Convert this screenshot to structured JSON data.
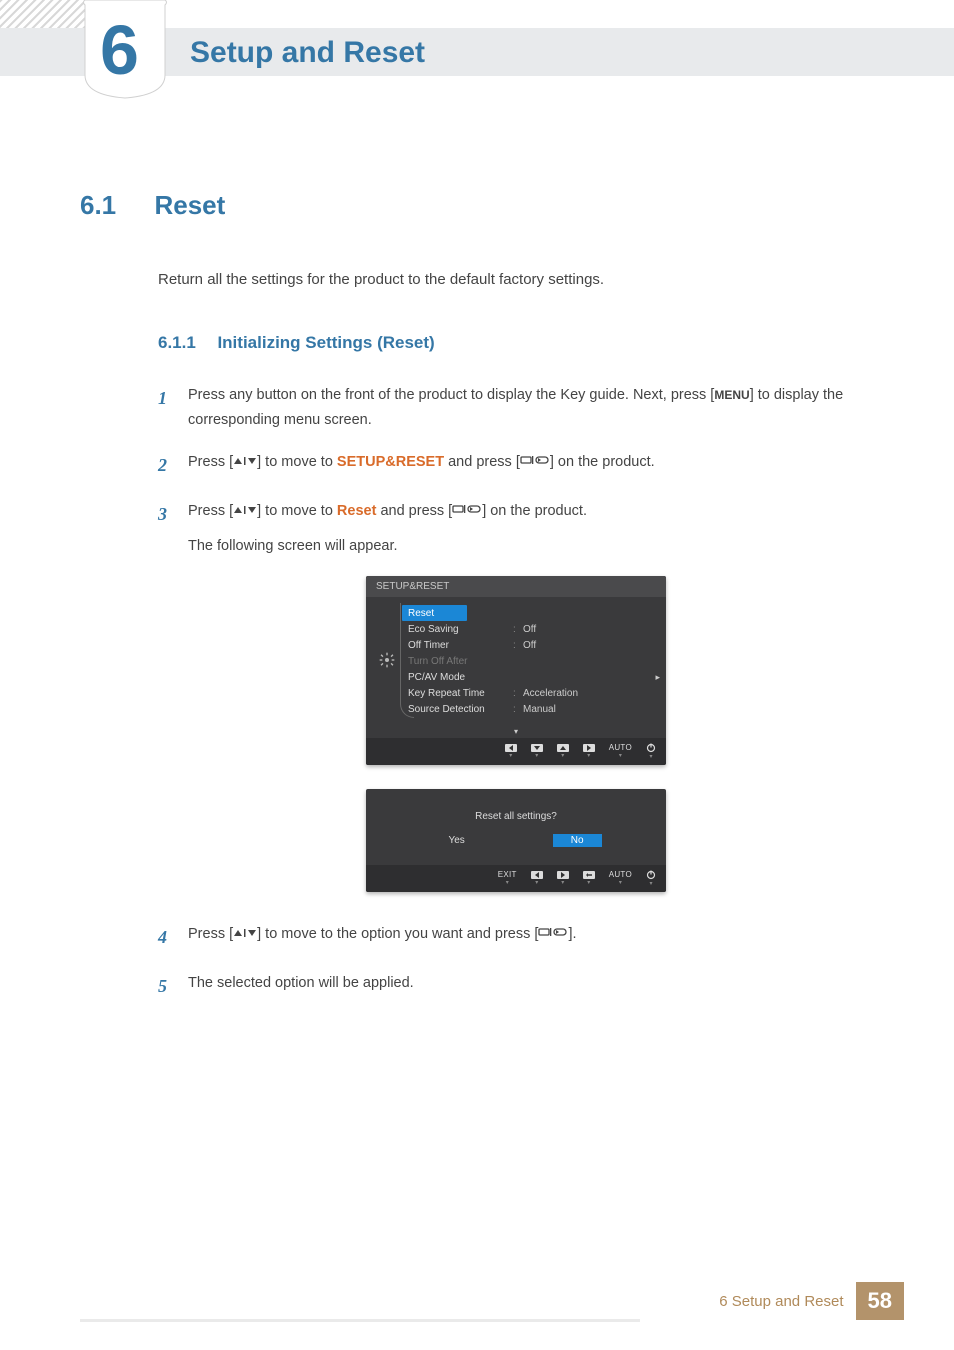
{
  "chapter": {
    "number": "6",
    "title": "Setup and Reset"
  },
  "section": {
    "number": "6.1",
    "title": "Reset",
    "intro": "Return all the settings for the product to the default factory settings."
  },
  "subsection": {
    "number": "6.1.1",
    "title": "Initializing Settings (Reset)"
  },
  "steps": {
    "s1": {
      "num": "1",
      "a": "Press any button on the front of the product to display the Key guide. Next, press [",
      "menu": "MENU",
      "b": "] to display the corresponding menu screen."
    },
    "s2": {
      "num": "2",
      "a": "Press [",
      "b": "] to move to ",
      "hl": "SETUP&RESET",
      "c": " and press [",
      "d": "] on the product."
    },
    "s3": {
      "num": "3",
      "a": "Press [",
      "b": "] to move to ",
      "hl": "Reset",
      "c": " and press [",
      "d": "] on the product.",
      "after": "The following screen will appear."
    },
    "s4": {
      "num": "4",
      "a": "Press [",
      "b": "] to move to the option you want and press [",
      "c": "]."
    },
    "s5": {
      "num": "5",
      "a": "The selected option will be applied."
    }
  },
  "osd1": {
    "title": "SETUP&RESET",
    "items": [
      {
        "label": "Reset",
        "value": "",
        "selected": true
      },
      {
        "label": "Eco Saving",
        "value": "Off"
      },
      {
        "label": "Off Timer",
        "value": "Off"
      },
      {
        "label": "Turn Off After",
        "value": "",
        "dim": true
      },
      {
        "label": "PC/AV Mode",
        "value": ""
      },
      {
        "label": "Key Repeat Time",
        "value": "Acceleration"
      },
      {
        "label": "Source Detection",
        "value": "Manual"
      }
    ],
    "auto": "AUTO"
  },
  "osd2": {
    "question": "Reset all settings?",
    "yes": "Yes",
    "no": "No",
    "exit": "EXIT",
    "auto": "AUTO"
  },
  "footer": {
    "text": "6 Setup and Reset",
    "page": "58"
  }
}
